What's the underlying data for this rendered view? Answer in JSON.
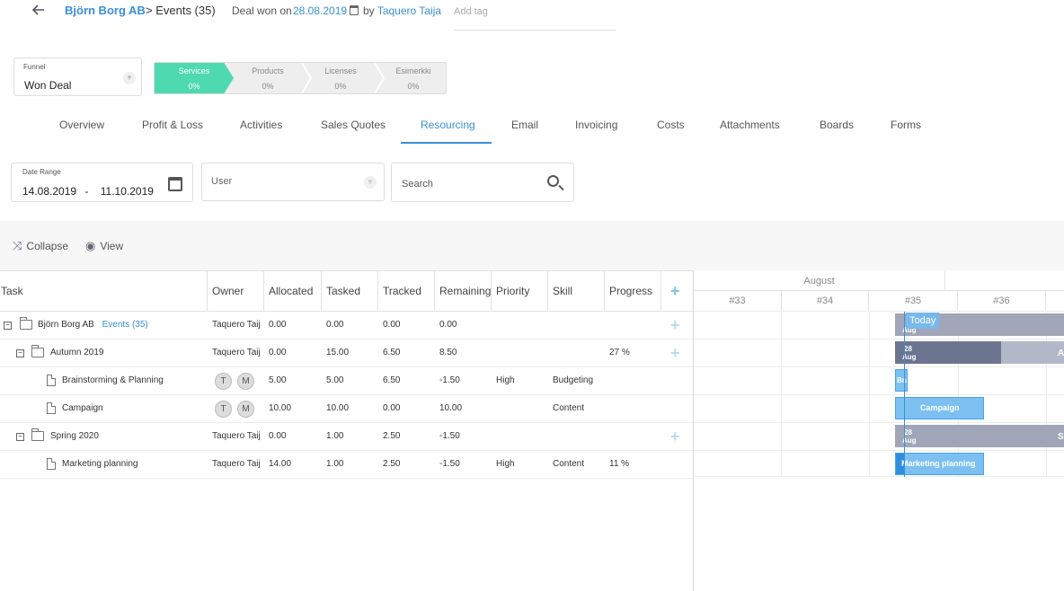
{
  "header": {
    "company": "Björn Borg AB",
    "crumb": "> Events (35)",
    "deal_won_label": "Deal won on",
    "deal_won_date": "28.08.2019",
    "by_label": "by",
    "owner": "Taquero Taija",
    "add_tag_placeholder": "Add tag"
  },
  "funnel": {
    "label": "Funnel",
    "value": "Won Deal",
    "stages": [
      {
        "name": "Services",
        "pct": "0%"
      },
      {
        "name": "Products",
        "pct": "0%"
      },
      {
        "name": "Licenses",
        "pct": "0%"
      },
      {
        "name": "Esimerkki",
        "pct": "0%"
      }
    ]
  },
  "tabs": [
    "Overview",
    "Profit & Loss",
    "Activities",
    "Sales Quotes",
    "Resourcing",
    "Email",
    "Invoicing",
    "Costs",
    "Attachments",
    "Boards",
    "Forms"
  ],
  "filters": {
    "date_range_label": "Date Range",
    "date_from": "14.08.2019",
    "date_sep": "-",
    "date_to": "11.10.2019",
    "user_placeholder": "User",
    "search_placeholder": "Search"
  },
  "toolbar": {
    "collapse": "Collapse",
    "view": "View"
  },
  "grid": {
    "columns": [
      "Task",
      "Owner",
      "Allocated",
      "Tasked",
      "Tracked",
      "Remaining",
      "Priority",
      "Skill",
      "Progress"
    ],
    "rows": [
      {
        "task": "Björn Borg AB",
        "link": "Events (35)",
        "owner": "Taquero Taij",
        "allocated": "0.00",
        "tasked": "0.00",
        "tracked": "0.00",
        "remaining": "0.00",
        "priority": "",
        "skill": "",
        "progress": ""
      },
      {
        "task": "Autumn 2019",
        "owner": "Taquero Taij",
        "allocated": "0.00",
        "tasked": "15.00",
        "tracked": "6.50",
        "remaining": "8.50",
        "priority": "",
        "skill": "",
        "progress": "27 %"
      },
      {
        "task": "Brainstorming & Planning",
        "avatars": [
          "T",
          "M"
        ],
        "allocated": "5.00",
        "tasked": "5.00",
        "tracked": "6.50",
        "remaining": "-1.50",
        "priority": "High",
        "skill": "Budgeting",
        "progress": ""
      },
      {
        "task": "Campaign",
        "avatars": [
          "T",
          "M"
        ],
        "allocated": "10.00",
        "tasked": "10.00",
        "tracked": "0.00",
        "remaining": "10.00",
        "priority": "",
        "skill": "Content",
        "progress": ""
      },
      {
        "task": "Spring 2020",
        "owner": "Taquero Taij",
        "allocated": "0.00",
        "tasked": "1.00",
        "tracked": "2.50",
        "remaining": "-1.50",
        "priority": "",
        "skill": "",
        "progress": ""
      },
      {
        "task": "Marketing planning",
        "owner": "Taquero Taij",
        "allocated": "14.00",
        "tasked": "1.00",
        "tracked": "2.50",
        "remaining": "-1.50",
        "priority": "High",
        "skill": "Content",
        "progress": "11 %"
      }
    ]
  },
  "gantt": {
    "month": "August",
    "weeks": [
      "#33",
      "#34",
      "#35",
      "#36"
    ],
    "today_label": "Today",
    "bars": {
      "row0": "Aug",
      "row1_day": "28",
      "row1_month": "Aug",
      "row1_end": "A",
      "row2": "Bra",
      "row3": "Campaign",
      "row4_day": "28",
      "row4_month": "Aug",
      "row4_end": "S",
      "row5": "Marketing planning"
    },
    "colors": {
      "summary": "#a0a6b8",
      "summary_dark": "#6c7590",
      "task": "#7cc0f2",
      "task_border": "#4aa3e6"
    }
  }
}
